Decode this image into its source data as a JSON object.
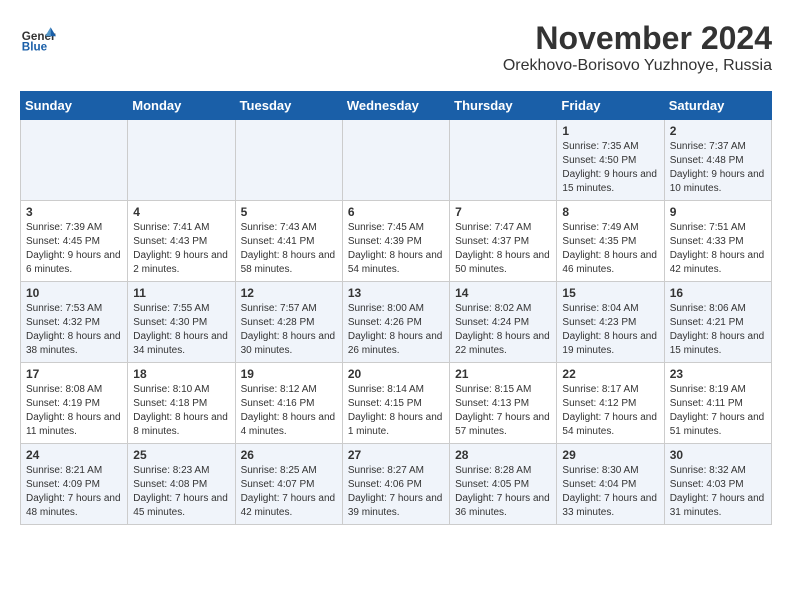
{
  "logo": {
    "general": "General",
    "blue": "Blue"
  },
  "header": {
    "month": "November 2024",
    "location": "Orekhovo-Borisovo Yuzhnoye, Russia"
  },
  "weekdays": [
    "Sunday",
    "Monday",
    "Tuesday",
    "Wednesday",
    "Thursday",
    "Friday",
    "Saturday"
  ],
  "weeks": [
    [
      {
        "day": "",
        "info": ""
      },
      {
        "day": "",
        "info": ""
      },
      {
        "day": "",
        "info": ""
      },
      {
        "day": "",
        "info": ""
      },
      {
        "day": "",
        "info": ""
      },
      {
        "day": "1",
        "info": "Sunrise: 7:35 AM\nSunset: 4:50 PM\nDaylight: 9 hours and 15 minutes."
      },
      {
        "day": "2",
        "info": "Sunrise: 7:37 AM\nSunset: 4:48 PM\nDaylight: 9 hours and 10 minutes."
      }
    ],
    [
      {
        "day": "3",
        "info": "Sunrise: 7:39 AM\nSunset: 4:45 PM\nDaylight: 9 hours and 6 minutes."
      },
      {
        "day": "4",
        "info": "Sunrise: 7:41 AM\nSunset: 4:43 PM\nDaylight: 9 hours and 2 minutes."
      },
      {
        "day": "5",
        "info": "Sunrise: 7:43 AM\nSunset: 4:41 PM\nDaylight: 8 hours and 58 minutes."
      },
      {
        "day": "6",
        "info": "Sunrise: 7:45 AM\nSunset: 4:39 PM\nDaylight: 8 hours and 54 minutes."
      },
      {
        "day": "7",
        "info": "Sunrise: 7:47 AM\nSunset: 4:37 PM\nDaylight: 8 hours and 50 minutes."
      },
      {
        "day": "8",
        "info": "Sunrise: 7:49 AM\nSunset: 4:35 PM\nDaylight: 8 hours and 46 minutes."
      },
      {
        "day": "9",
        "info": "Sunrise: 7:51 AM\nSunset: 4:33 PM\nDaylight: 8 hours and 42 minutes."
      }
    ],
    [
      {
        "day": "10",
        "info": "Sunrise: 7:53 AM\nSunset: 4:32 PM\nDaylight: 8 hours and 38 minutes."
      },
      {
        "day": "11",
        "info": "Sunrise: 7:55 AM\nSunset: 4:30 PM\nDaylight: 8 hours and 34 minutes."
      },
      {
        "day": "12",
        "info": "Sunrise: 7:57 AM\nSunset: 4:28 PM\nDaylight: 8 hours and 30 minutes."
      },
      {
        "day": "13",
        "info": "Sunrise: 8:00 AM\nSunset: 4:26 PM\nDaylight: 8 hours and 26 minutes."
      },
      {
        "day": "14",
        "info": "Sunrise: 8:02 AM\nSunset: 4:24 PM\nDaylight: 8 hours and 22 minutes."
      },
      {
        "day": "15",
        "info": "Sunrise: 8:04 AM\nSunset: 4:23 PM\nDaylight: 8 hours and 19 minutes."
      },
      {
        "day": "16",
        "info": "Sunrise: 8:06 AM\nSunset: 4:21 PM\nDaylight: 8 hours and 15 minutes."
      }
    ],
    [
      {
        "day": "17",
        "info": "Sunrise: 8:08 AM\nSunset: 4:19 PM\nDaylight: 8 hours and 11 minutes."
      },
      {
        "day": "18",
        "info": "Sunrise: 8:10 AM\nSunset: 4:18 PM\nDaylight: 8 hours and 8 minutes."
      },
      {
        "day": "19",
        "info": "Sunrise: 8:12 AM\nSunset: 4:16 PM\nDaylight: 8 hours and 4 minutes."
      },
      {
        "day": "20",
        "info": "Sunrise: 8:14 AM\nSunset: 4:15 PM\nDaylight: 8 hours and 1 minute."
      },
      {
        "day": "21",
        "info": "Sunrise: 8:15 AM\nSunset: 4:13 PM\nDaylight: 7 hours and 57 minutes."
      },
      {
        "day": "22",
        "info": "Sunrise: 8:17 AM\nSunset: 4:12 PM\nDaylight: 7 hours and 54 minutes."
      },
      {
        "day": "23",
        "info": "Sunrise: 8:19 AM\nSunset: 4:11 PM\nDaylight: 7 hours and 51 minutes."
      }
    ],
    [
      {
        "day": "24",
        "info": "Sunrise: 8:21 AM\nSunset: 4:09 PM\nDaylight: 7 hours and 48 minutes."
      },
      {
        "day": "25",
        "info": "Sunrise: 8:23 AM\nSunset: 4:08 PM\nDaylight: 7 hours and 45 minutes."
      },
      {
        "day": "26",
        "info": "Sunrise: 8:25 AM\nSunset: 4:07 PM\nDaylight: 7 hours and 42 minutes."
      },
      {
        "day": "27",
        "info": "Sunrise: 8:27 AM\nSunset: 4:06 PM\nDaylight: 7 hours and 39 minutes."
      },
      {
        "day": "28",
        "info": "Sunrise: 8:28 AM\nSunset: 4:05 PM\nDaylight: 7 hours and 36 minutes."
      },
      {
        "day": "29",
        "info": "Sunrise: 8:30 AM\nSunset: 4:04 PM\nDaylight: 7 hours and 33 minutes."
      },
      {
        "day": "30",
        "info": "Sunrise: 8:32 AM\nSunset: 4:03 PM\nDaylight: 7 hours and 31 minutes."
      }
    ]
  ]
}
